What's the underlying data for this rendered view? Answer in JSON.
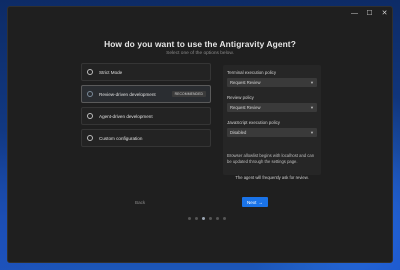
{
  "window": {
    "controls": {
      "minimize": "—",
      "maximize": "☐",
      "close": "✕"
    }
  },
  "header": {
    "title": "How do you want to use the Antigravity Agent?",
    "subtitle": "Select one of the options below."
  },
  "options": [
    {
      "label": "Strict Mode",
      "selected": false,
      "badge": ""
    },
    {
      "label": "Review-driven development",
      "selected": true,
      "badge": "RECOMMENDED"
    },
    {
      "label": "Agent-driven development",
      "selected": false,
      "badge": ""
    },
    {
      "label": "Custom configuration",
      "selected": false,
      "badge": ""
    }
  ],
  "panel": {
    "terminal_policy": {
      "label": "Terminal execution policy",
      "value": "Request Review"
    },
    "review_policy": {
      "label": "Review policy",
      "value": "Request Review"
    },
    "javascript_policy": {
      "label": "JavaScript execution policy",
      "value": "Disabled"
    },
    "note": "Browser allowlist begins with localhost and can be updated through the settings page."
  },
  "agent_note": "The agent will frequently ask for review.",
  "footer": {
    "back_label": "Back",
    "next_label": "Next",
    "next_icon": "→",
    "steps_total": 6,
    "current_step": 3
  },
  "colors": {
    "accent": "#1a73e8",
    "window_bg": "#1f1f1f",
    "panel_bg": "#262626"
  }
}
